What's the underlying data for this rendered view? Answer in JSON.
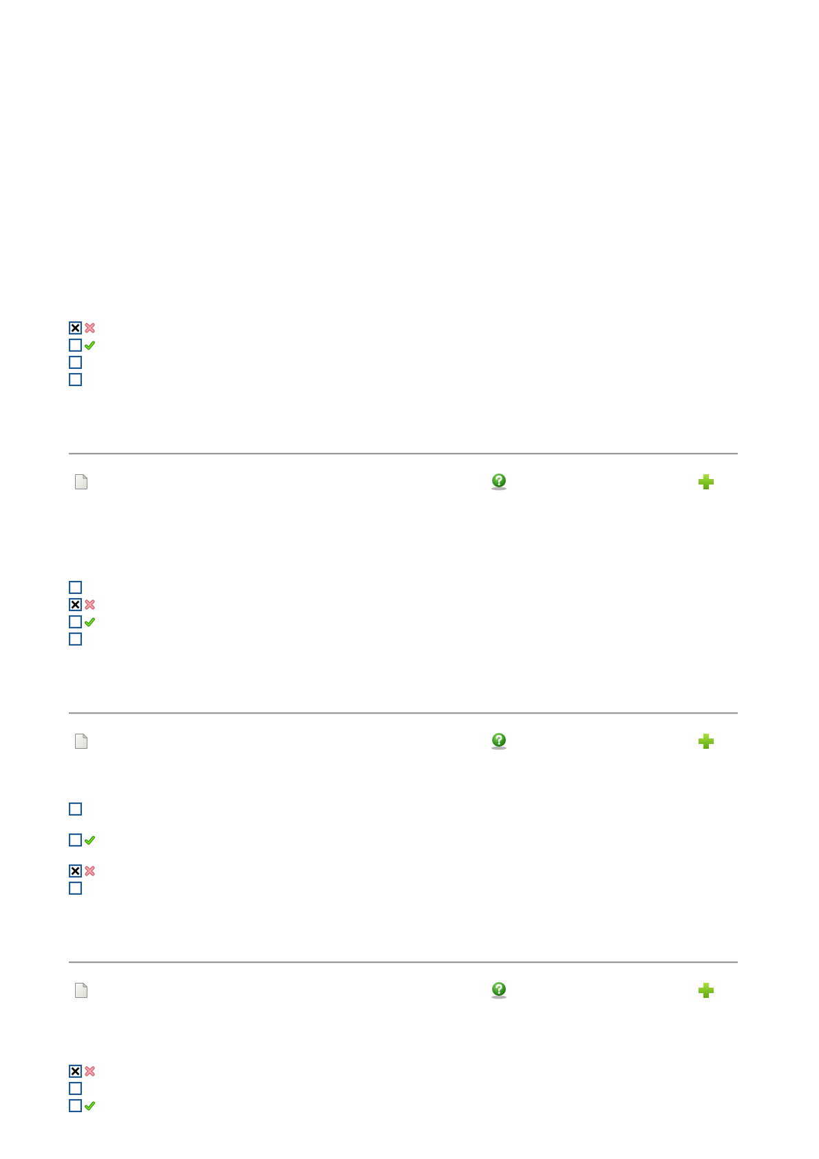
{
  "sections": [
    {
      "kind": "answers",
      "options": [
        {
          "checked": true,
          "kind": "wrong"
        },
        {
          "checked": false,
          "kind": "correct"
        },
        {
          "checked": false,
          "kind": "plain"
        },
        {
          "checked": false,
          "kind": "plain"
        }
      ]
    },
    {
      "kind": "toolbar"
    },
    {
      "kind": "answers",
      "options": [
        {
          "checked": false,
          "kind": "plain"
        },
        {
          "checked": true,
          "kind": "wrong"
        },
        {
          "checked": false,
          "kind": "correct"
        },
        {
          "checked": false,
          "kind": "plain"
        }
      ]
    },
    {
      "kind": "toolbar"
    },
    {
      "kind": "answers",
      "options": [
        {
          "checked": false,
          "kind": "plain"
        },
        {
          "checked": false,
          "kind": "correct"
        },
        {
          "checked": true,
          "kind": "wrong"
        },
        {
          "checked": false,
          "kind": "plain"
        }
      ]
    },
    {
      "kind": "toolbar"
    },
    {
      "kind": "answers",
      "options": [
        {
          "checked": true,
          "kind": "wrong"
        },
        {
          "checked": false,
          "kind": "plain"
        },
        {
          "checked": false,
          "kind": "correct"
        }
      ]
    }
  ]
}
